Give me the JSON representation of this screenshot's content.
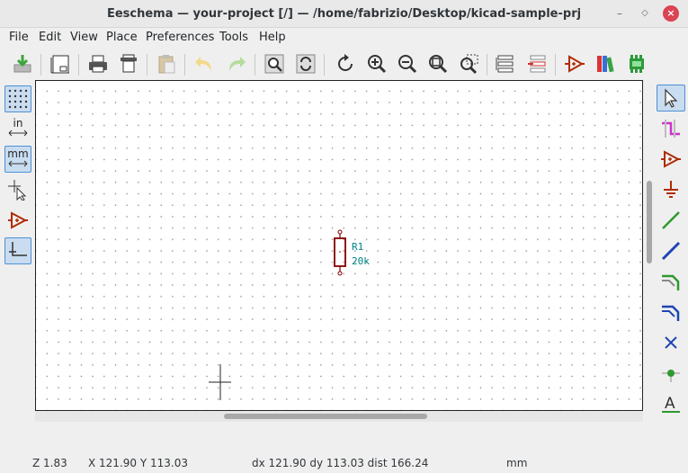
{
  "window": {
    "title": "Eeschema — your-project [/] — /home/fabrizio/Desktop/kicad-sample-prj",
    "close_glyph": "×",
    "min_glyph": "–",
    "max_glyph": "◇"
  },
  "menu": [
    "File",
    "Edit",
    "View",
    "Place",
    "Preferences",
    "Tools",
    "Help"
  ],
  "toolbar": {
    "icons": [
      "save-icon",
      "page-settings-icon",
      "print-icon",
      "plot-icon",
      "paste-icon",
      "undo-icon",
      "redo-icon",
      "find-icon",
      "find-replace-icon",
      "redraw-icon",
      "zoom-in-icon",
      "zoom-out-icon",
      "zoom-fit-icon",
      "zoom-selection-icon",
      "hierarchy-navigator-icon",
      "leave-sheet-icon",
      "symbol-editor-icon",
      "symbol-library-browser-icon",
      "annotate-icon"
    ]
  },
  "left_toolbar": {
    "unit_in": "in",
    "unit_mm": "mm"
  },
  "schematic": {
    "component": {
      "reference": "R1",
      "value": "20k"
    }
  },
  "status": {
    "zoom": "Z 1.83",
    "coords": "X 121.90  Y 113.03",
    "delta": "dx 121.90  dy 113.03  dist 166.24",
    "units": "mm"
  },
  "colors": {
    "accent": "#4d90d6",
    "component": "#840000",
    "field_text": "#008484",
    "grid": "#9a9a9a",
    "close": "#da4453"
  }
}
